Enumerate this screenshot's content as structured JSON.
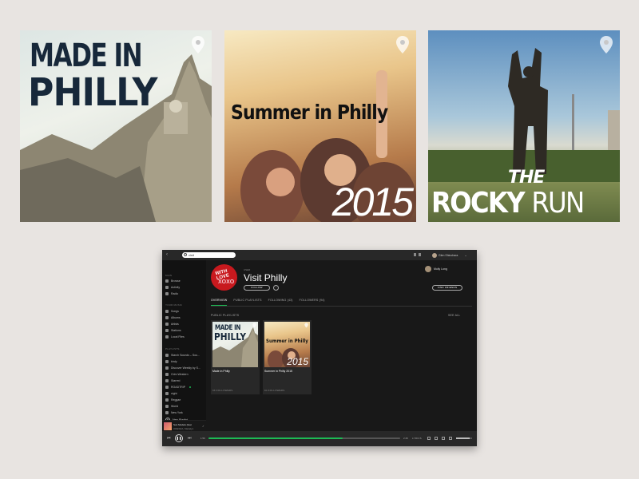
{
  "covers": [
    {
      "line1": "MADE IN",
      "line2": "PHILLY",
      "pin_icon": "location-pin-icon"
    },
    {
      "line1": "Summer in Philly",
      "year": "2015",
      "pin_icon": "location-pin-icon"
    },
    {
      "the": "THE",
      "rocky": "ROCKY",
      "run": "RUN",
      "pin_icon": "location-pin-icon"
    }
  ],
  "app": {
    "topbar": {
      "search_value": "visit",
      "user_name": "Glen Shinohara"
    },
    "sidebar": {
      "main_header": "MAIN",
      "main_items": [
        {
          "label": "Browse",
          "icon": "browse-icon"
        },
        {
          "label": "Activity",
          "icon": "activity-icon"
        },
        {
          "label": "Radio",
          "icon": "radio-icon"
        }
      ],
      "music_header": "YOUR MUSIC",
      "music_items": [
        {
          "label": "Songs",
          "icon": "songs-icon"
        },
        {
          "label": "Albums",
          "icon": "albums-icon"
        },
        {
          "label": "Artists",
          "icon": "artists-icon"
        },
        {
          "label": "Stations",
          "icon": "stations-icon"
        },
        {
          "label": "Local Files",
          "icon": "local-files-icon"
        }
      ],
      "playlists_header": "PLAYLISTS",
      "playlists": [
        "Starch Sounds – Sou...",
        "birdy",
        "Discover Weekly by S...",
        "Grim Western",
        "Starred",
        "ROADTRIP",
        "night",
        "Reggae",
        "World",
        "New York"
      ],
      "new_playlist": "New Playlist"
    },
    "now_playing": {
      "title": "Sun Models (feat",
      "artist": "ODESZA, Madelyn"
    },
    "profile": {
      "kind": "USER",
      "name": "Visit Philly",
      "follow_label": "FOLLOW",
      "more_label": "···",
      "owner_name": "Molly Long",
      "find_friends_label": "FIND FRIENDS",
      "logo_line1": "WITH LOVE",
      "logo_line2": "XOXO"
    },
    "tabs": [
      "OVERVIEW",
      "PUBLIC PLAYLISTS",
      "FOLLOWING (43)",
      "FOLLOWERS (94)"
    ],
    "section": {
      "label": "PUBLIC PLAYLISTS",
      "see_all": "SEE ALL"
    },
    "playlist_cards": [
      {
        "name": "Made in Philly",
        "followers": "96 FOLLOWERS",
        "art_line1": "MADE IN",
        "art_line2": "PHILLY"
      },
      {
        "name": "Summer in Philly 2015",
        "followers": "94 FOLLOWERS",
        "art_line1": "Summer in Philly",
        "art_line2": "2015"
      }
    ],
    "player": {
      "current_time": "1:56",
      "total_time": "2:45",
      "lyrics_label": "LYRICS",
      "progress": 0.7,
      "volume": 0.85
    }
  },
  "colors": {
    "accent": "#1db954",
    "background": "#e8e4e1",
    "app_bg": "#181818"
  }
}
